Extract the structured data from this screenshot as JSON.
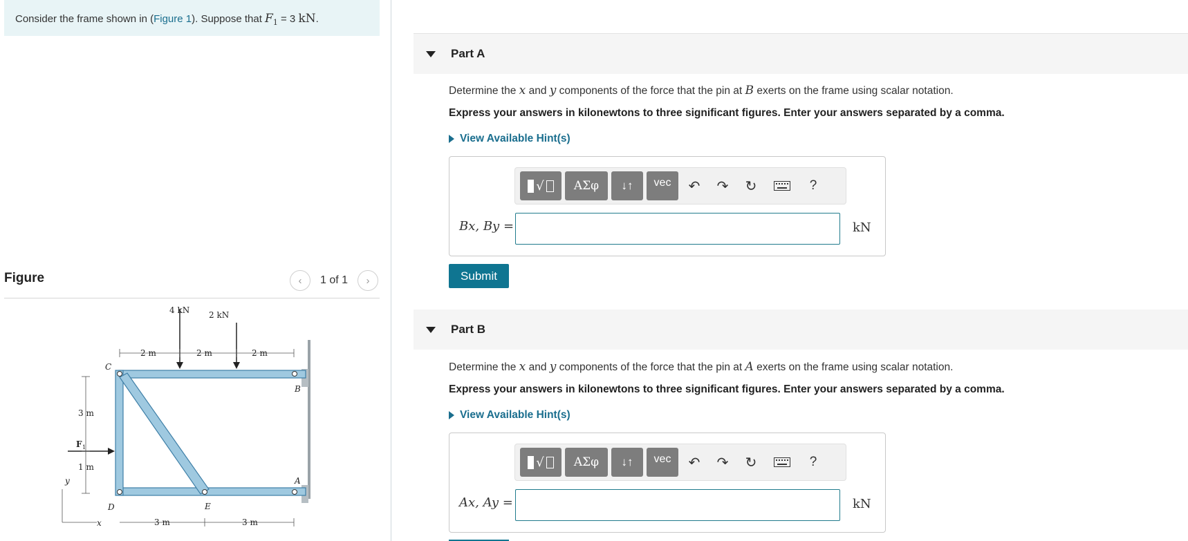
{
  "problem": {
    "prefix": "Consider the frame shown in (",
    "link": "Figure 1",
    "middle": "). Suppose that ",
    "var": "F",
    "sub": "1",
    "eq": " = 3 ",
    "unit": "kN",
    "end": "."
  },
  "figure": {
    "title": "Figure",
    "pager": "1 of 1",
    "prev_icon": "chevron-left",
    "next_icon": "chevron-right",
    "labels": {
      "load1": "4 kN",
      "load2": "2 kN",
      "dim_top1": "2 m",
      "dim_top2": "2 m",
      "dim_top3": "2 m",
      "dim_left1": "3 m",
      "dim_left2": "1 m",
      "dim_bot1": "3 m",
      "dim_bot2": "3 m",
      "pt_c": "C",
      "pt_b": "B",
      "pt_a": "A",
      "pt_d": "D",
      "pt_e": "E",
      "force": "F",
      "force_sub": "1",
      "axis_y": "y",
      "axis_x": "x"
    },
    "colors": {
      "member": "#9fc9e0",
      "member_edge": "#3d7ea6",
      "wall": "#9aa3a8"
    }
  },
  "parts": [
    {
      "title": "Part A",
      "q_pre": "Determine the ",
      "q_x": "x",
      "q_and": " and ",
      "q_y": "y",
      "q_mid": " components of the force that the pin at ",
      "q_pt": "B",
      "q_post": " exerts on the frame using scalar notation.",
      "instruction": "Express your answers in kilonewtons to three significant figures. Enter your answers separated by a comma.",
      "hint": "View Available Hint(s)",
      "label": "Bx, By =",
      "value": "",
      "unit": "kN",
      "submit": "Submit"
    },
    {
      "title": "Part B",
      "q_pre": "Determine the ",
      "q_x": "x",
      "q_and": " and ",
      "q_y": "y",
      "q_mid": " components of the force that the pin at ",
      "q_pt": "A",
      "q_post": " exerts on the frame using scalar notation.",
      "instruction": "Express your answers in kilonewtons to three significant figures. Enter your answers separated by a comma.",
      "hint": "View Available Hint(s)",
      "label": "Ax, Ay =",
      "value": "",
      "unit": "kN"
    }
  ],
  "toolbar": {
    "greek": "ΑΣφ",
    "arrows": "↓↑",
    "vec": "vec",
    "undo_icon": "undo-arrow",
    "redo_icon": "redo-arrow",
    "reset_icon": "reset-circle",
    "keyboard_icon": "keyboard",
    "help": "?"
  },
  "colors": {
    "accent": "#0f7591",
    "link": "#1a6e8e",
    "problem_bg": "#e8f4f6",
    "part_header_bg": "#f5f5f5"
  }
}
